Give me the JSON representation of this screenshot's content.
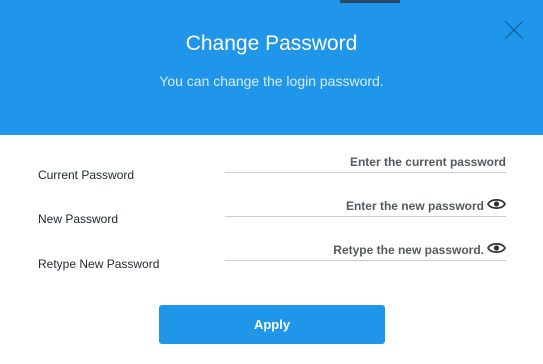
{
  "dialog": {
    "title": "Change Password",
    "subtitle": "You can change the login password.",
    "close_icon": "close-icon",
    "accent_color": "#1f96ea"
  },
  "fields": {
    "current": {
      "label": "Current Password",
      "placeholder": "Enter the current password",
      "value": ""
    },
    "new": {
      "label": "New Password",
      "placeholder": "Enter the new password",
      "value": "",
      "icon": "eye-icon"
    },
    "retype": {
      "label": "Retype New Password",
      "placeholder": "Retype the new password.",
      "value": "",
      "icon": "eye-icon"
    }
  },
  "actions": {
    "apply_label": "Apply"
  }
}
